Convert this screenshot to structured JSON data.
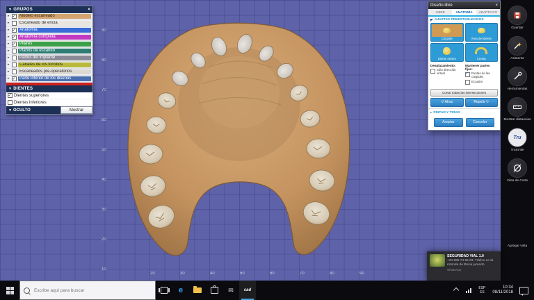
{
  "colors": {
    "viewport_bg": "#5e62a8",
    "model_stone": "#c4935f",
    "accent_blue": "#2d9bd6",
    "accent_cyan": "#25b0e2",
    "group_header_bg": "#1c2f55",
    "taskbar_bg": "#0b0b0f"
  },
  "icons": {
    "collapse": "▼",
    "expand": "▸",
    "close": "×",
    "undo": "↺",
    "redo": "↻",
    "edge": "e",
    "mail": "✉"
  },
  "groups_panel": {
    "title": "GRUPOS",
    "groups": [
      {
        "label": "Modelo escaneado",
        "color": "#d2a470",
        "text": "#3a2a14",
        "checked": true
      },
      {
        "label": "Escaneado de encía",
        "color": "#e9e5df",
        "text": "#333333",
        "checked": false
      },
      {
        "label": "Anatomía",
        "color": "#3a6bd6",
        "text": "#ffffff",
        "checked": true
      },
      {
        "label": "Anatomía completa",
        "color": "#c23ac2",
        "text": "#ffffff",
        "checked": true
      },
      {
        "label": "Pilares",
        "color": "#3ba048",
        "text": "#ffffff",
        "checked": true
      },
      {
        "label": "Planos de escaneo",
        "color": "#2e7d74",
        "text": "#ffffff",
        "checked": false
      },
      {
        "label": "Partes del implante",
        "color": "#8a8a96",
        "text": "#ffffff",
        "checked": false
      },
      {
        "label": "Canales de los tornillos",
        "color": "#b9b93c",
        "text": "#2e2e10",
        "checked": false
      },
      {
        "label": "Escaneados pre-operatorios",
        "color": "#dcd8d2",
        "text": "#333333",
        "checked": false
      },
      {
        "label": "Parte inferior de los diseños",
        "color": "#4a6fb0",
        "text": "#ffffff",
        "checked": true
      }
    ],
    "dientes_title": "DIENTES",
    "dientes": [
      {
        "label": "Dientes superiores",
        "checked": true
      },
      {
        "label": "Dientes inferiores",
        "checked": false
      }
    ],
    "oculto_title": "OCULTO",
    "mostrar_button": "Mostrar"
  },
  "viewport": {
    "ruler_bottom": [
      "20",
      "30",
      "40",
      "50",
      "60",
      "70",
      "80",
      "90"
    ],
    "ruler_left": [
      "90",
      "80",
      "70",
      "60",
      "50",
      "40",
      "30",
      "20",
      "10"
    ]
  },
  "dialog": {
    "title": "Diseño libre",
    "tabs": [
      {
        "label": "LIBRE"
      },
      {
        "label": "ANATOMÍA"
      },
      {
        "label": "ADAPTACIÓ"
      }
    ],
    "presets_section": "AJUSTES PREESTABLECIDOS",
    "presets": [
      {
        "label": "Cúspide"
      },
      {
        "label": "Área del diente"
      },
      {
        "label": "Diente entero"
      },
      {
        "label": "Cresta"
      }
    ],
    "desplazamiento": "Desplazamiento:",
    "solo_direccion": "Sólo dirección virtual",
    "solo_checked": false,
    "mantener": "Mantener partes fijas:",
    "options": [
      {
        "label": "Puntas de las cúspides",
        "checked": true
      },
      {
        "label": "Ecuador",
        "checked": false
      }
    ],
    "cortar": "Cortar todas las intersecciones",
    "atras": "Atras",
    "repetir": "Repetir",
    "pintar_section": "PINTAR Y TIRAR",
    "aceptar": "Aceptar",
    "cancelar": "Cancelar"
  },
  "toolbar": {
    "items": [
      {
        "label": "Guardar"
      },
      {
        "label": "Asistente"
      },
      {
        "label": "Herramientas"
      },
      {
        "label": "Mostrar distancias"
      },
      {
        "label": "TruSmile"
      },
      {
        "label": "Vista de Corte"
      }
    ],
    "tru_badge": "Tru",
    "bottom_label": "Agregar vista"
  },
  "notification": {
    "title": "SEGURIDAD VIAL 1.0",
    "body": "+34 699 74 56 93: Tráfico en la rotonda de Bricia jurando",
    "app": "WhatsApp"
  },
  "taskbar": {
    "search_placeholder": "Escribe aquí para buscar",
    "cad_label": "cad",
    "tray": {
      "lang1": "ESP",
      "lang2": "ES",
      "time": "10:34",
      "date": "08/11/2018"
    }
  }
}
